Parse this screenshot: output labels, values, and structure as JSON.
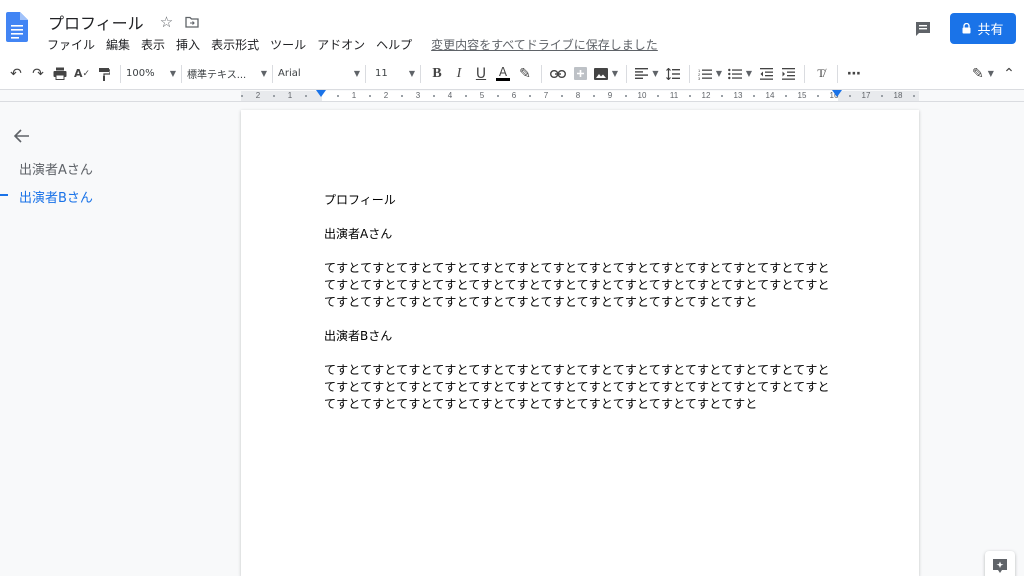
{
  "app": {
    "title": "プロフィール",
    "save_status": "変更内容をすべてドライブに保存しました",
    "share_label": "共有"
  },
  "menu": [
    "ファイル",
    "編集",
    "表示",
    "挿入",
    "表示形式",
    "ツール",
    "アドオン",
    "ヘルプ"
  ],
  "toolbar": {
    "zoom": "100%",
    "style": "標準テキス...",
    "font": "Arial",
    "font_size": "11"
  },
  "ruler": {
    "labels": [
      "2",
      "1",
      "1",
      "2",
      "3",
      "4",
      "5",
      "6",
      "7",
      "8",
      "9",
      "10",
      "11",
      "12",
      "13",
      "14",
      "15",
      "16",
      "17",
      "18"
    ]
  },
  "outline": {
    "items": [
      {
        "label": "出演者Aさん",
        "active": false
      },
      {
        "label": "出演者Bさん",
        "active": true
      }
    ]
  },
  "document": {
    "title": "プロフィール",
    "sections": [
      {
        "heading": "出演者Aさん",
        "body": "てすとてすとてすとてすとてすとてすとてすとてすとてすとてすとてすとてすとてすとてすとてすとてすとてすとてすとてすとてすとてすとてすとてすとてすとてすとてすとてすとてすとてすとてすとてすとてすとてすとてすとてすとてすとてすとてすとてすとてすと"
      },
      {
        "heading": "出演者Bさん",
        "body": "てすとてすとてすとてすとてすとてすとてすとてすとてすとてすとてすとてすとてすとてすとてすとてすとてすとてすとてすとてすとてすとてすとてすとてすとてすとてすとてすとてすとてすとてすとてすとてすとてすとてすとてすとてすとてすとてすとてすとてすと"
      }
    ]
  },
  "colors": {
    "accent": "#1a73e8",
    "doc_icon": "#4285f4"
  }
}
